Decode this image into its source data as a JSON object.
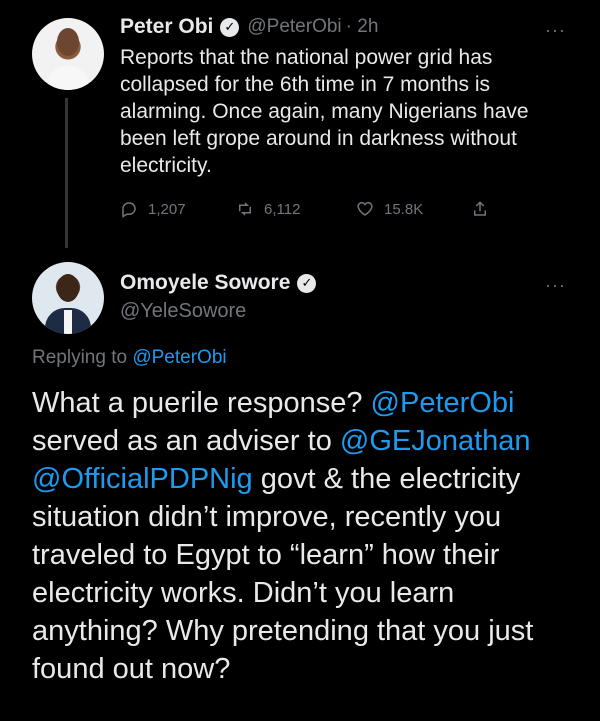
{
  "tweet1": {
    "author_name": "Peter Obi",
    "author_handle": "@PeterObi",
    "time": "· 2h",
    "more_label": "···",
    "text": "Reports that the national power grid has collapsed for the 6th time in 7 months is alarming. Once again, many Nigerians have been left grope around in darkness without electricity.",
    "actions": {
      "reply_count": "1,207",
      "retweet_count": "6,112",
      "like_count": "15.8K"
    }
  },
  "tweet2": {
    "author_name": "Omoyele Sowore",
    "author_handle": "@YeleSowore",
    "more_label": "···",
    "replying_to_prefix": "Replying to",
    "replying_to_handle": "@PeterObi",
    "segments": [
      {
        "text": "What a puerile response? ",
        "mention": false
      },
      {
        "text": "@PeterObi",
        "mention": true
      },
      {
        "text": " served as an adviser to ",
        "mention": false
      },
      {
        "text": "@GEJonathan",
        "mention": true
      },
      {
        "text": " ",
        "mention": false
      },
      {
        "text": "@OfficialPDPNig",
        "mention": true
      },
      {
        "text": " govt & the electricity situation didn’t improve, recently you traveled to Egypt to “learn” how their electricity works. Didn’t you learn anything? Why pretending that you just found out now?",
        "mention": false
      }
    ]
  },
  "colors": {
    "background": "#000000",
    "text": "#e7e9ea",
    "muted": "#71767b",
    "link": "#1d9bf0"
  },
  "icons": {
    "verified": "verified-badge-icon",
    "reply": "reply-icon",
    "retweet": "retweet-icon",
    "like": "heart-icon",
    "share": "share-icon",
    "more": "more-icon"
  }
}
